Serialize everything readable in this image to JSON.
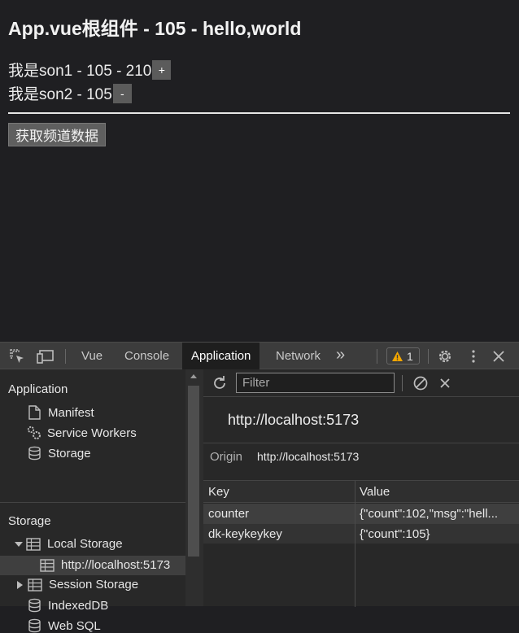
{
  "page": {
    "title": "App.vue根组件 - 105 - hello,world",
    "son1_text": "我是son1 - 105 - 210",
    "son1_button": "+",
    "son2_text": "我是son2 - 105",
    "son2_button": "-",
    "fetch_button": "获取频道数据"
  },
  "devtools": {
    "tabs": [
      "Vue",
      "Console",
      "Application",
      "Network"
    ],
    "active_tab": "Application",
    "more_tabs": "»",
    "warning_count": "1",
    "sidebar": {
      "application_heading": "Application",
      "application_items": [
        "Manifest",
        "Service Workers",
        "Storage"
      ],
      "storage_heading": "Storage",
      "local_storage": "Local Storage",
      "local_storage_origin": "http://localhost:5173",
      "session_storage": "Session Storage",
      "indexeddb": "IndexedDB",
      "websql": "Web SQL"
    },
    "main": {
      "filter_placeholder": "Filter",
      "origin_title": "http://localhost:5173",
      "origin_label": "Origin",
      "origin_value": "http://localhost:5173",
      "columns": [
        "Key",
        "Value"
      ],
      "rows": [
        {
          "key": "counter",
          "value": "{\"count\":102,\"msg\":\"hell..."
        },
        {
          "key": "dk-keykeykey",
          "value": "{\"count\":105}"
        }
      ]
    },
    "colors": {
      "accent_warning": "#f2a600",
      "active_tab_bg": "#1e1e1e"
    }
  }
}
